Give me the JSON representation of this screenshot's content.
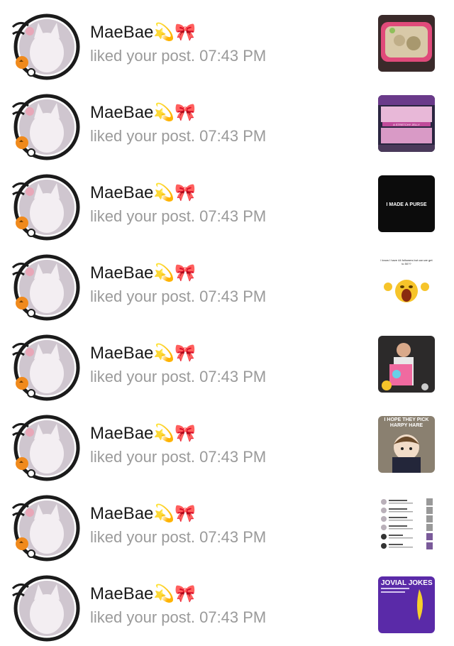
{
  "notifications": [
    {
      "username": "MaeBae💫🎀",
      "action": "liked your post.",
      "time": "07:43 PM",
      "thumb_icon": "food-tray-thumbnail"
    },
    {
      "username": "MaeBae💫🎀",
      "action": "liked your post.",
      "time": "07:43 PM",
      "thumb_icon": "store-shelf-thumbnail",
      "thumb_text": "A STRETCHY JELLY"
    },
    {
      "username": "MaeBae💫🎀",
      "action": "liked your post.",
      "time": "07:43 PM",
      "thumb_icon": "text-card-thumbnail",
      "thumb_text": "I MADE A PURSE"
    },
    {
      "username": "MaeBae💫🎀",
      "action": "liked your post.",
      "time": "07:43 PM",
      "thumb_icon": "crying-emoji-thumbnail",
      "thumb_text": "I know I have 44 followers but can we get to 50??"
    },
    {
      "username": "MaeBae💫🎀",
      "action": "liked your post.",
      "time": "07:43 PM",
      "thumb_icon": "person-box-thumbnail"
    },
    {
      "username": "MaeBae💫🎀",
      "action": "liked your post.",
      "time": "07:43 PM",
      "thumb_icon": "plush-doll-thumbnail",
      "thumb_text": "I HOPE THEY PICK HARPY HARE"
    },
    {
      "username": "MaeBae💫🎀",
      "action": "liked your post.",
      "time": "07:43 PM",
      "thumb_icon": "list-screenshot-thumbnail"
    },
    {
      "username": "MaeBae💫🎀",
      "action": "liked your post.",
      "time": "07:43 PM",
      "thumb_icon": "banana-card-thumbnail",
      "thumb_text": "JOVIAL JOKES"
    }
  ]
}
